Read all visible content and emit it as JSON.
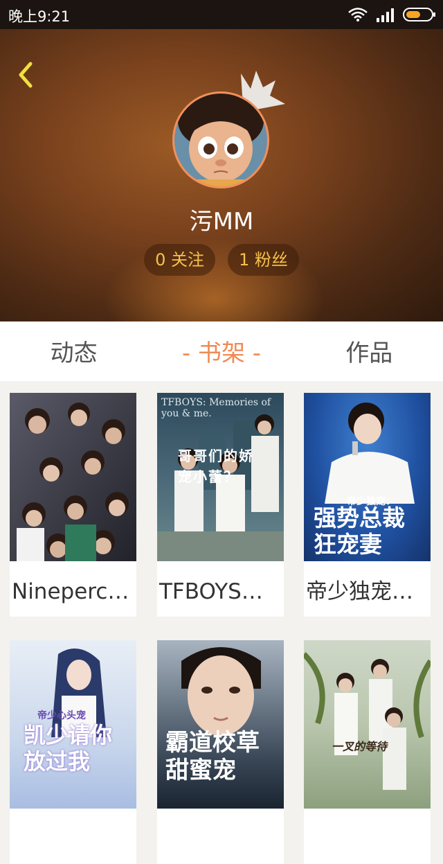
{
  "status": {
    "time": "晚上9:21"
  },
  "profile": {
    "username": "污MM",
    "following_label": "0 关注",
    "fans_label": "1 粉丝"
  },
  "tabs": [
    {
      "label": "动态"
    },
    {
      "label": "- 书架 -"
    },
    {
      "label": "作品"
    }
  ],
  "books": [
    {
      "title": "Ninepercent（...",
      "cover_text": ""
    },
    {
      "title": "TFBOYS：...",
      "cover_text": "哥哥们的娇宠小蕾？",
      "cover_sub": "TFBOYS: Memories of you & me."
    },
    {
      "title": "帝少独宠：...",
      "cover_text": "强势总裁狂宠妻",
      "cover_sub": "帝少独宠："
    },
    {
      "title": "",
      "cover_text": "凯少请你放过我",
      "cover_sub": "帝少心头宠"
    },
    {
      "title": "",
      "cover_text": "霸道校草甜蜜宠"
    },
    {
      "title": "",
      "cover_text": "一叉的等待"
    }
  ],
  "colors": {
    "accent": "#f08a55",
    "pill_text": "#f5c24a"
  }
}
